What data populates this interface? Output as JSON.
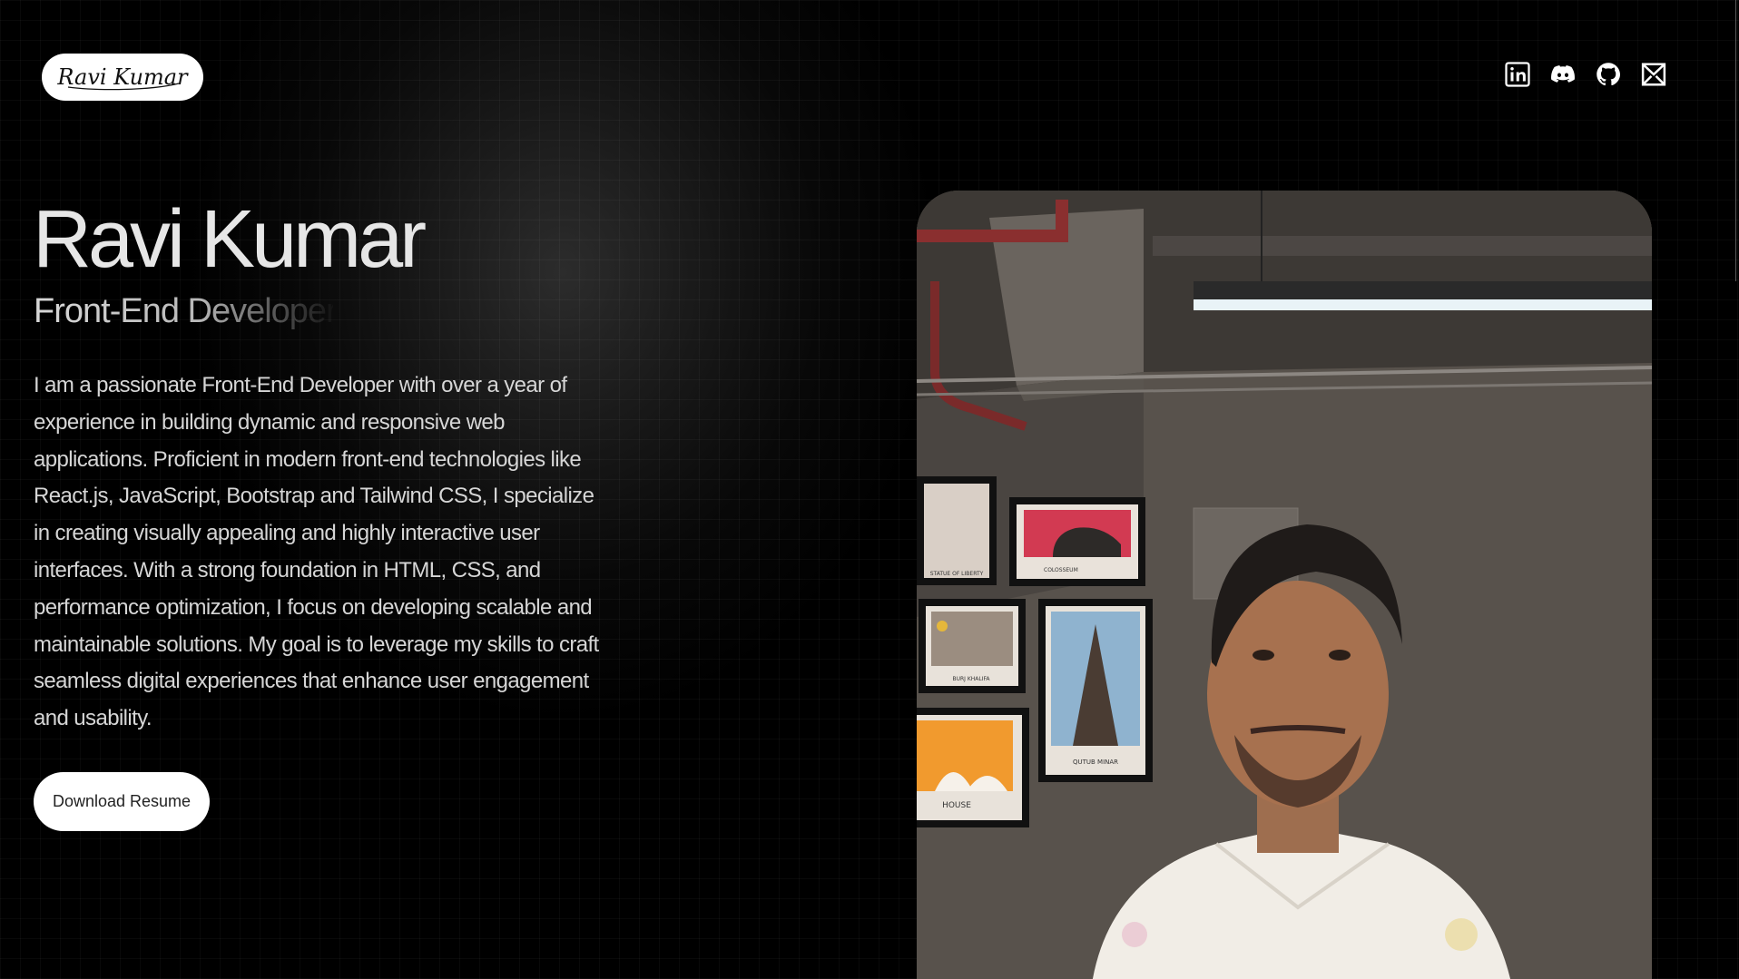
{
  "logo": {
    "text": "Ravi Kumar"
  },
  "social": [
    {
      "icon": "linkedin-icon"
    },
    {
      "icon": "discord-icon"
    },
    {
      "icon": "github-icon"
    },
    {
      "icon": "mail-icon"
    }
  ],
  "hero": {
    "name": "Ravi Kumar",
    "role": "Front-End Developer",
    "bio": "I am a passionate Front-End Developer with over a year of experience in building dynamic and responsive web applications. Proficient in modern front-end technologies like React.js, JavaScript, Bootstrap and Tailwind CSS, I specialize in creating visually appealing and highly interactive user interfaces. With a strong foundation in HTML, CSS, and performance optimization, I focus on developing scalable and maintainable solutions. My goal is to leverage my skills to craft seamless digital experiences that enhance user engagement and usability.",
    "cta": "Download Resume"
  },
  "photo": {
    "poster_labels": [
      "STATUE OF LIBERTY",
      "COLOSSEUM",
      "BURJ KHALIFA",
      "QUTUB MINAR",
      "HOUSE"
    ]
  },
  "colors": {
    "background": "#000000",
    "text": "#e6e6e6",
    "button_bg": "#ffffff"
  }
}
